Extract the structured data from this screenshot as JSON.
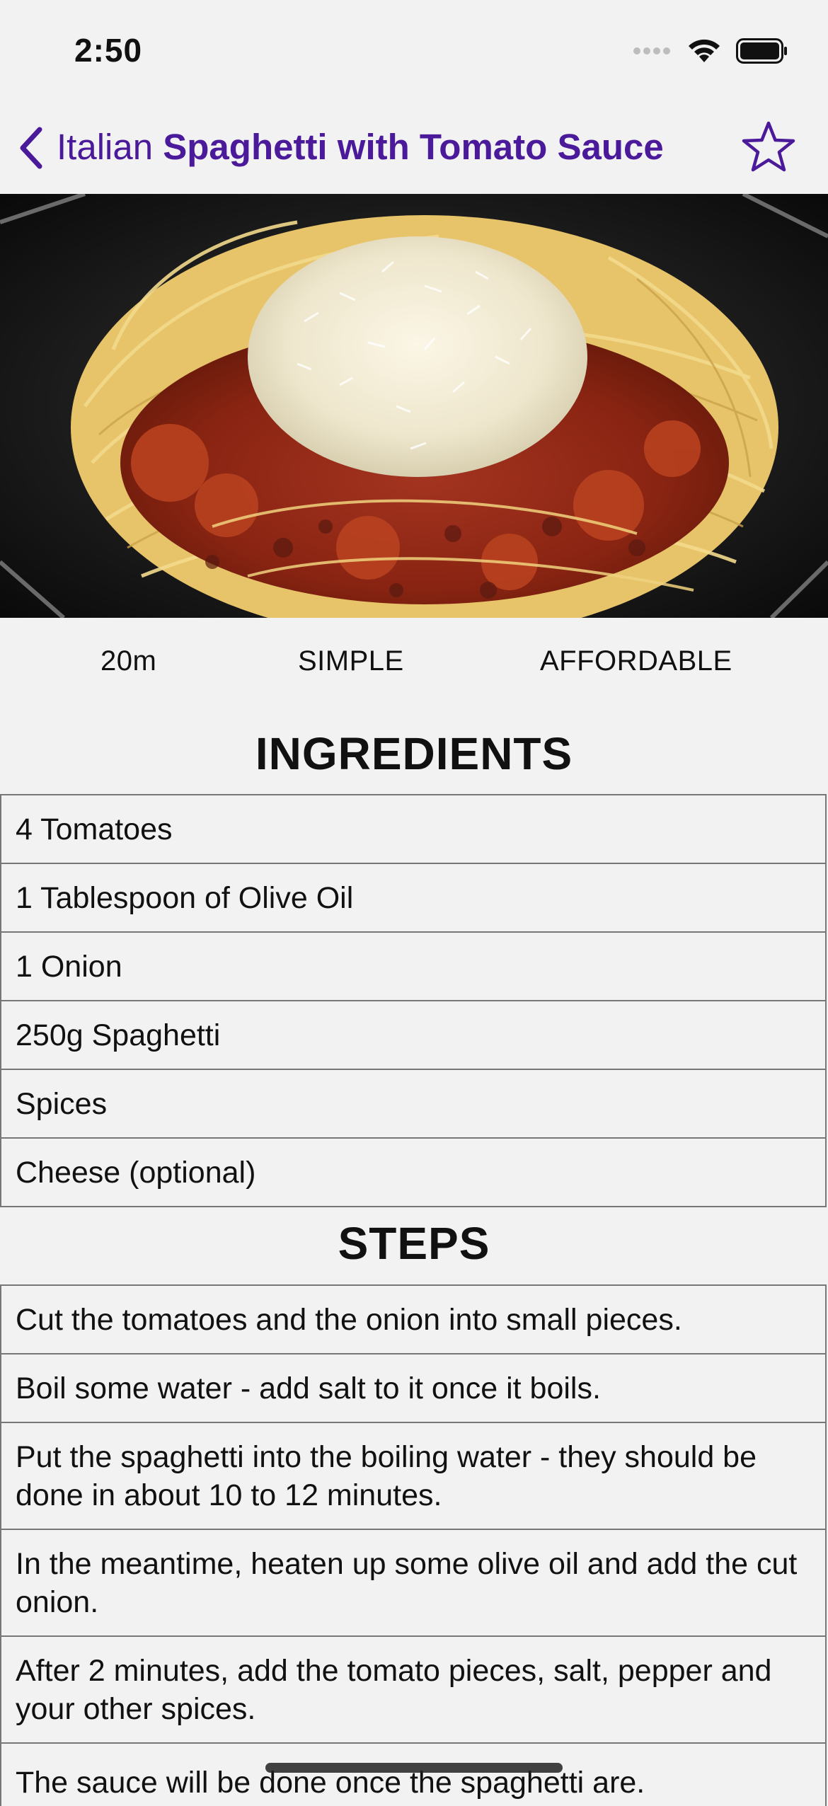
{
  "status": {
    "time": "2:50"
  },
  "nav": {
    "category": "Italian",
    "title": "Spaghetti with Tomato Sauce",
    "accent_color": "#4a1a9a"
  },
  "hero_image": {
    "subject": "spaghetti with tomato meat sauce and grated cheese"
  },
  "meta": {
    "duration": "20m",
    "complexity": "SIMPLE",
    "affordability": "AFFORDABLE"
  },
  "ingredients": {
    "heading": "INGREDIENTS",
    "items": [
      "4 Tomatoes",
      "1 Tablespoon of Olive Oil",
      "1 Onion",
      "250g Spaghetti",
      "Spices",
      "Cheese (optional)"
    ]
  },
  "steps": {
    "heading": "STEPS",
    "items": [
      "Cut the tomatoes and the onion into small pieces.",
      "Boil some water - add salt to it once it boils.",
      "Put the spaghetti into the boiling water - they should be done in about 10 to 12 minutes.",
      "In the meantime, heaten up some olive oil and add the cut onion.",
      "After 2 minutes, add the tomato pieces, salt, pepper and your other spices.",
      "The sauce will be done once the spaghetti are."
    ]
  }
}
